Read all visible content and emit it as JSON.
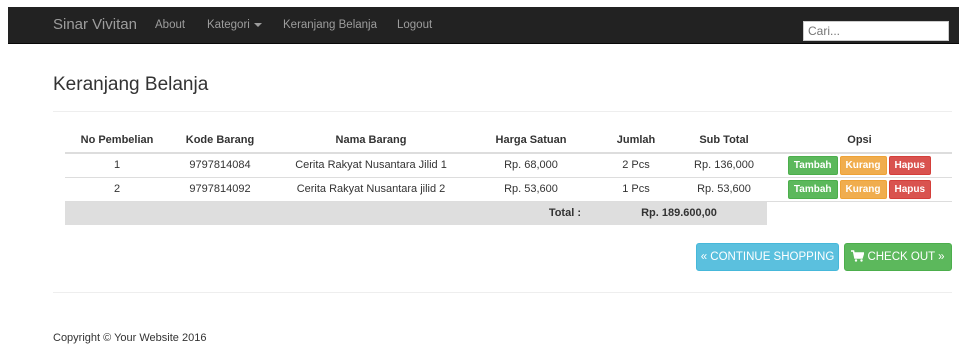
{
  "navbar": {
    "brand": "Sinar Vivitan",
    "links": [
      "About",
      "Kategori",
      "Keranjang Belanja",
      "Logout"
    ],
    "search_placeholder": "Cari..."
  },
  "page": {
    "title": "Keranjang Belanja"
  },
  "table": {
    "headers": [
      "No Pembelian",
      "Kode Barang",
      "Nama Barang",
      "Harga Satuan",
      "Jumlah",
      "Sub Total",
      "Opsi"
    ],
    "rows": [
      {
        "no": "1",
        "kode": "9797814084",
        "nama": "Cerita Rakyat Nusantara Jilid 1",
        "harga": "Rp. 68,000",
        "jumlah": "2 Pcs",
        "subtotal": "Rp. 136,000"
      },
      {
        "no": "2",
        "kode": "9797814092",
        "nama": "Cerita Rakyat Nusantara jilid 2",
        "harga": "Rp. 53,600",
        "jumlah": "1 Pcs",
        "subtotal": "Rp. 53,600"
      }
    ],
    "actions": {
      "add": "Tambah",
      "reduce": "Kurang",
      "remove": "Hapus"
    },
    "total_label": "Total :",
    "total_value": "Rp. 189.600,00"
  },
  "buttons": {
    "continue": "« CONTINUE SHOPPING",
    "checkout": "CHECK OUT »"
  },
  "footer": {
    "copyright": "Copyright © Your Website 2016"
  },
  "colors": {
    "navbar_bg": "#222222",
    "info": "#5bc0de",
    "success": "#5cb85c",
    "warning": "#f0ad4e",
    "danger": "#d9534f",
    "total_row_bg": "#dedede"
  }
}
